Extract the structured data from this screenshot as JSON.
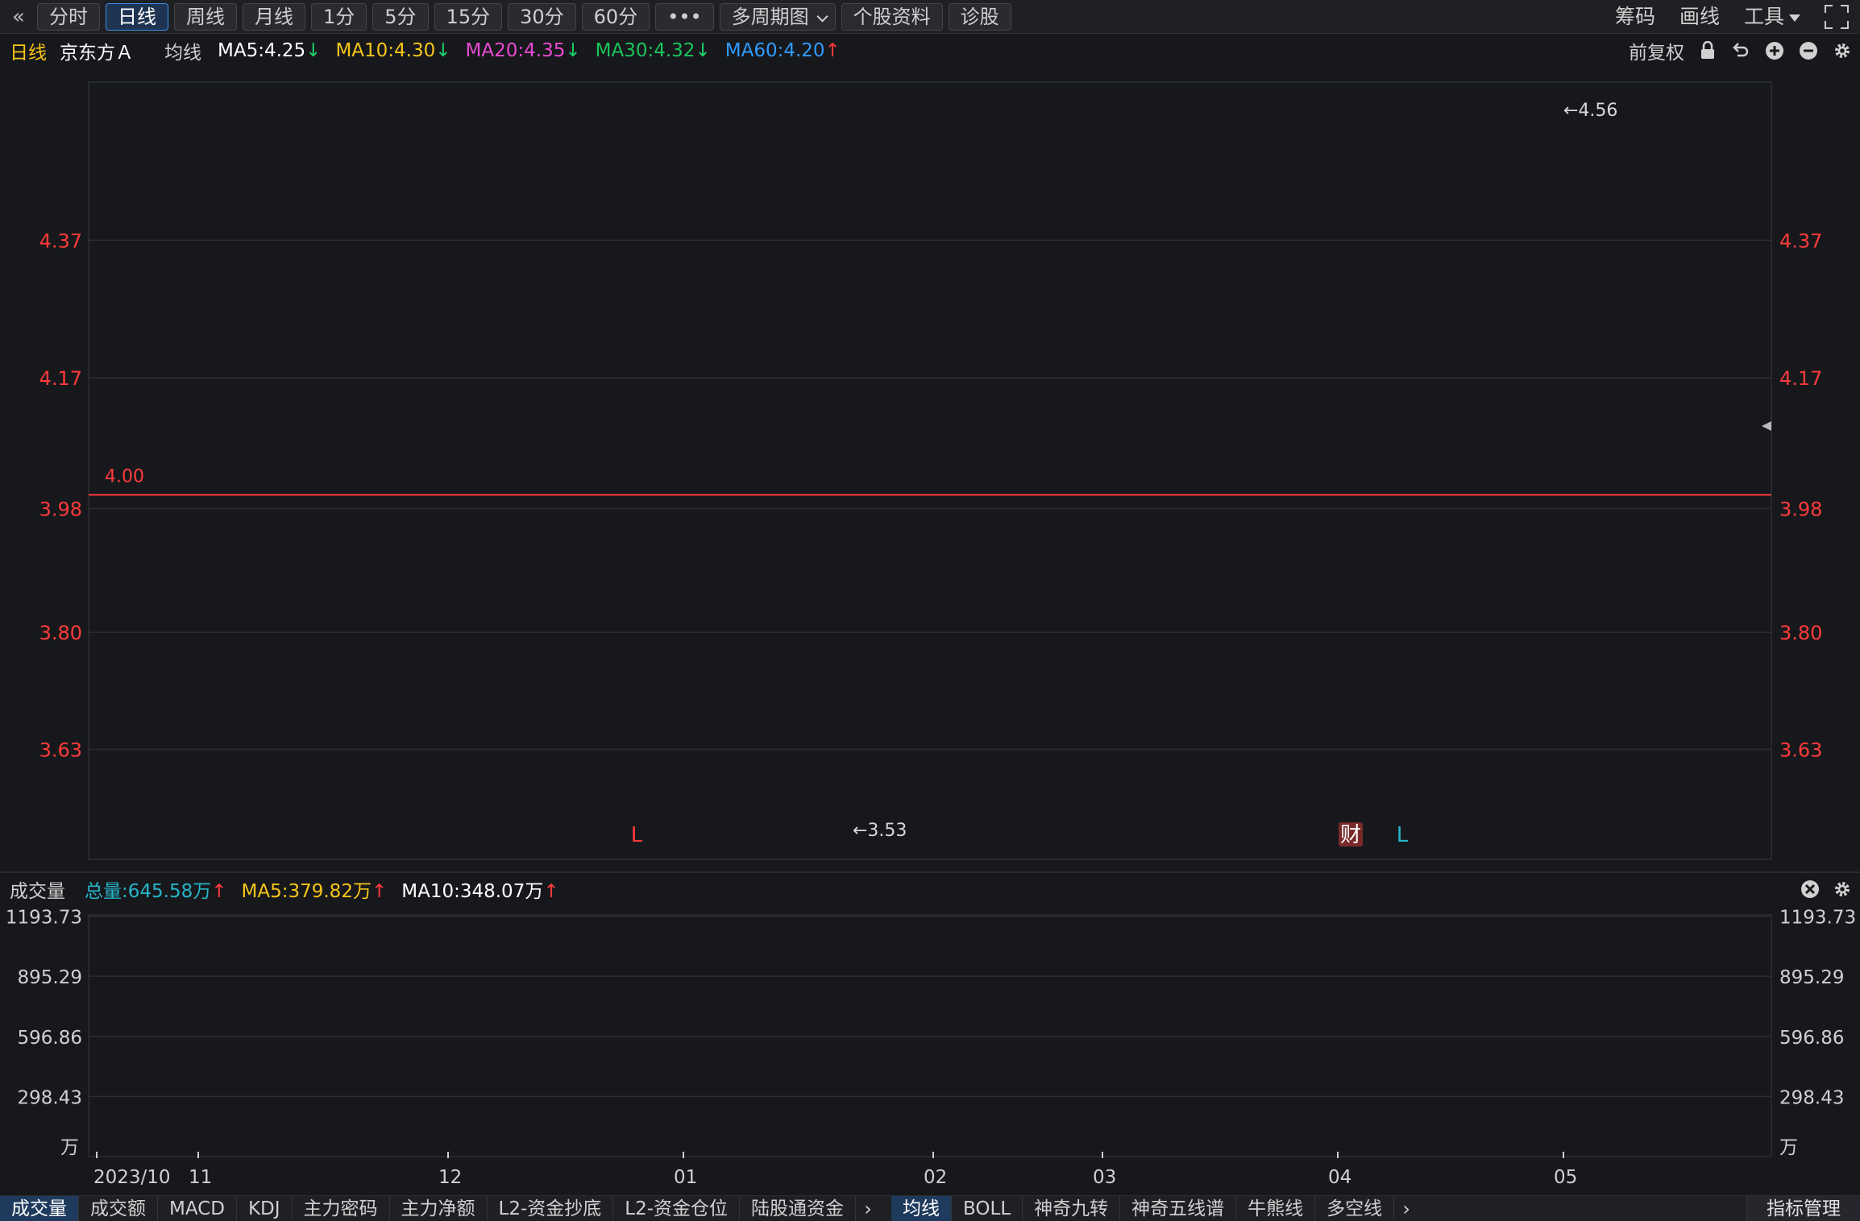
{
  "toolbar": {
    "periods": [
      {
        "label": "分时",
        "active": false
      },
      {
        "label": "日线",
        "active": true
      },
      {
        "label": "周线",
        "active": false
      },
      {
        "label": "月线",
        "active": false
      },
      {
        "label": "1分",
        "active": false
      },
      {
        "label": "5分",
        "active": false
      },
      {
        "label": "15分",
        "active": false
      },
      {
        "label": "30分",
        "active": false
      },
      {
        "label": "60分",
        "active": false
      },
      {
        "label": "•••",
        "active": false
      },
      {
        "label": "多周期图",
        "active": false
      },
      {
        "label": "个股资料",
        "active": false
      },
      {
        "label": "诊股",
        "active": false
      }
    ],
    "right": {
      "chips": "筹码",
      "draw": "画线",
      "tools": "工具"
    }
  },
  "legend": {
    "period": "日线",
    "stock_name": "京东方Ａ",
    "ma_label": "均线",
    "ma": [
      {
        "text": "MA5:4.25",
        "dir": "down",
        "color": "#ffffff"
      },
      {
        "text": "MA10:4.30",
        "dir": "down",
        "color": "#f5c518"
      },
      {
        "text": "MA20:4.35",
        "dir": "down",
        "color": "#e84ad2"
      },
      {
        "text": "MA30:4.32",
        "dir": "down",
        "color": "#19c45c"
      },
      {
        "text": "MA60:4.20",
        "dir": "up",
        "color": "#2f9bff"
      }
    ],
    "adjust": "前复权"
  },
  "chart_data": [
    {
      "type": "candlestick",
      "price_axis_ticks": [
        4.37,
        4.17,
        3.98,
        3.8,
        3.63
      ],
      "ylim": [
        3.47,
        4.6
      ],
      "reference_line": {
        "value": 4.0,
        "label": "4.00",
        "color": "#ff3b3b"
      },
      "annotations": [
        {
          "text": "←4.56",
          "value": 4.56,
          "kind": "period-high"
        },
        {
          "text": "←3.53",
          "value": 3.53,
          "kind": "period-low"
        }
      ],
      "markers": [
        {
          "text": "L",
          "color": "#ff3b3b",
          "month": "12",
          "day_offset_days": 22
        },
        {
          "text": "财",
          "color": "#ffffff",
          "bg": "#7a2a2a",
          "month": "04"
        },
        {
          "text": "L",
          "color": "#26b5c8",
          "month": "04",
          "day_offset_days": 2
        }
      ],
      "x_month_labels": [
        "2023/10",
        "11",
        "12",
        "01",
        "02",
        "03",
        "04",
        "05"
      ],
      "colors": {
        "up": "#ff3b3b",
        "down": "#13b5c6",
        "bg": "#17181c",
        "grid": "#2c2d33"
      },
      "latest_close": 4.1
    },
    {
      "type": "bar",
      "title": "成交量",
      "volume_axis_ticks": [
        1193.73,
        895.29,
        596.86,
        298.43
      ],
      "unit_label": "万",
      "ylim": [
        0,
        1200
      ],
      "legend": [
        {
          "text": "总量:645.58万",
          "dir": "up",
          "color": "#26b5c8"
        },
        {
          "text": "MA5:379.82万",
          "dir": "up",
          "color": "#f5c518"
        },
        {
          "text": "MA10:348.07万",
          "dir": "up",
          "color": "#ffffff"
        }
      ],
      "latest_volume": 645.58
    }
  ],
  "tabs_left": [
    "成交量",
    "成交额",
    "MACD",
    "KDJ",
    "主力密码",
    "主力净额",
    "L2-资金抄底",
    "L2-资金仓位",
    "陆股通资金"
  ],
  "tabs_left_active": 0,
  "tabs_right": [
    "均线",
    "BOLL",
    "神奇九转",
    "神奇五线谱",
    "牛熊线",
    "多空线"
  ],
  "tabs_right_active": 0,
  "tab_manage": "指标管理"
}
